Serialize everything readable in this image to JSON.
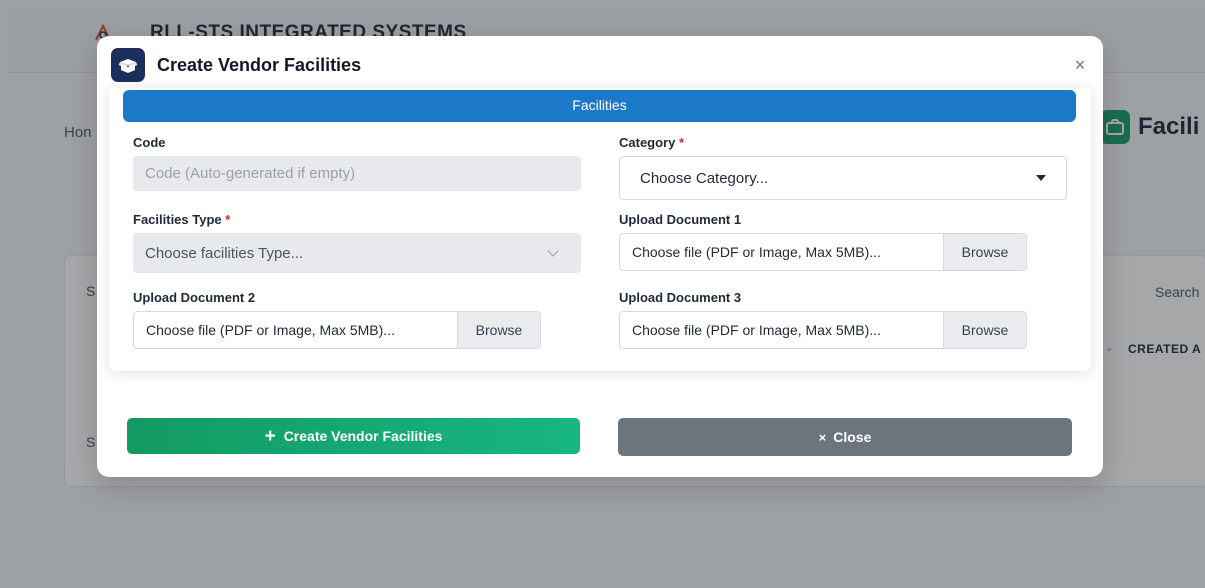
{
  "background": {
    "brand_name": "RLL-STS INTEGRATED SYSTEMS",
    "breadcrumb": "Hon",
    "page_title": "Facili",
    "search_label": "Search",
    "column_created": "CREATED A",
    "side_text_1": "S",
    "side_text_2": "S"
  },
  "modal": {
    "title": "Create Vendor Facilities",
    "close_symbol": "×",
    "section_title": "Facilities",
    "fields": {
      "code": {
        "label": "Code",
        "placeholder": "Code (Auto-generated if empty)"
      },
      "category": {
        "label": "Category",
        "required_mark": "*",
        "value": "Choose Category..."
      },
      "facilities_type": {
        "label": "Facilities Type",
        "required_mark": "*",
        "value": "Choose facilities Type..."
      },
      "upload_document_1": {
        "label": "Upload Document 1",
        "placeholder": "Choose file (PDF or Image, Max 5MB)...",
        "button": "Browse"
      },
      "upload_document_2": {
        "label": "Upload Document 2",
        "placeholder": "Choose file (PDF or Image, Max 5MB)...",
        "button": "Browse"
      },
      "upload_document_3": {
        "label": "Upload Document 3",
        "placeholder": "Choose file (PDF or Image, Max 5MB)...",
        "button": "Browse"
      }
    },
    "buttons": {
      "create": {
        "icon": "+",
        "label": "Create Vendor Facilities"
      },
      "close": {
        "icon": "×",
        "label": "Close"
      }
    }
  },
  "colors": {
    "section_band": "#1c78c8",
    "create_button": "#149a63",
    "close_button": "#6c757d",
    "modal_icon_bg": "#1d2d5c",
    "required": "#dc2626"
  }
}
